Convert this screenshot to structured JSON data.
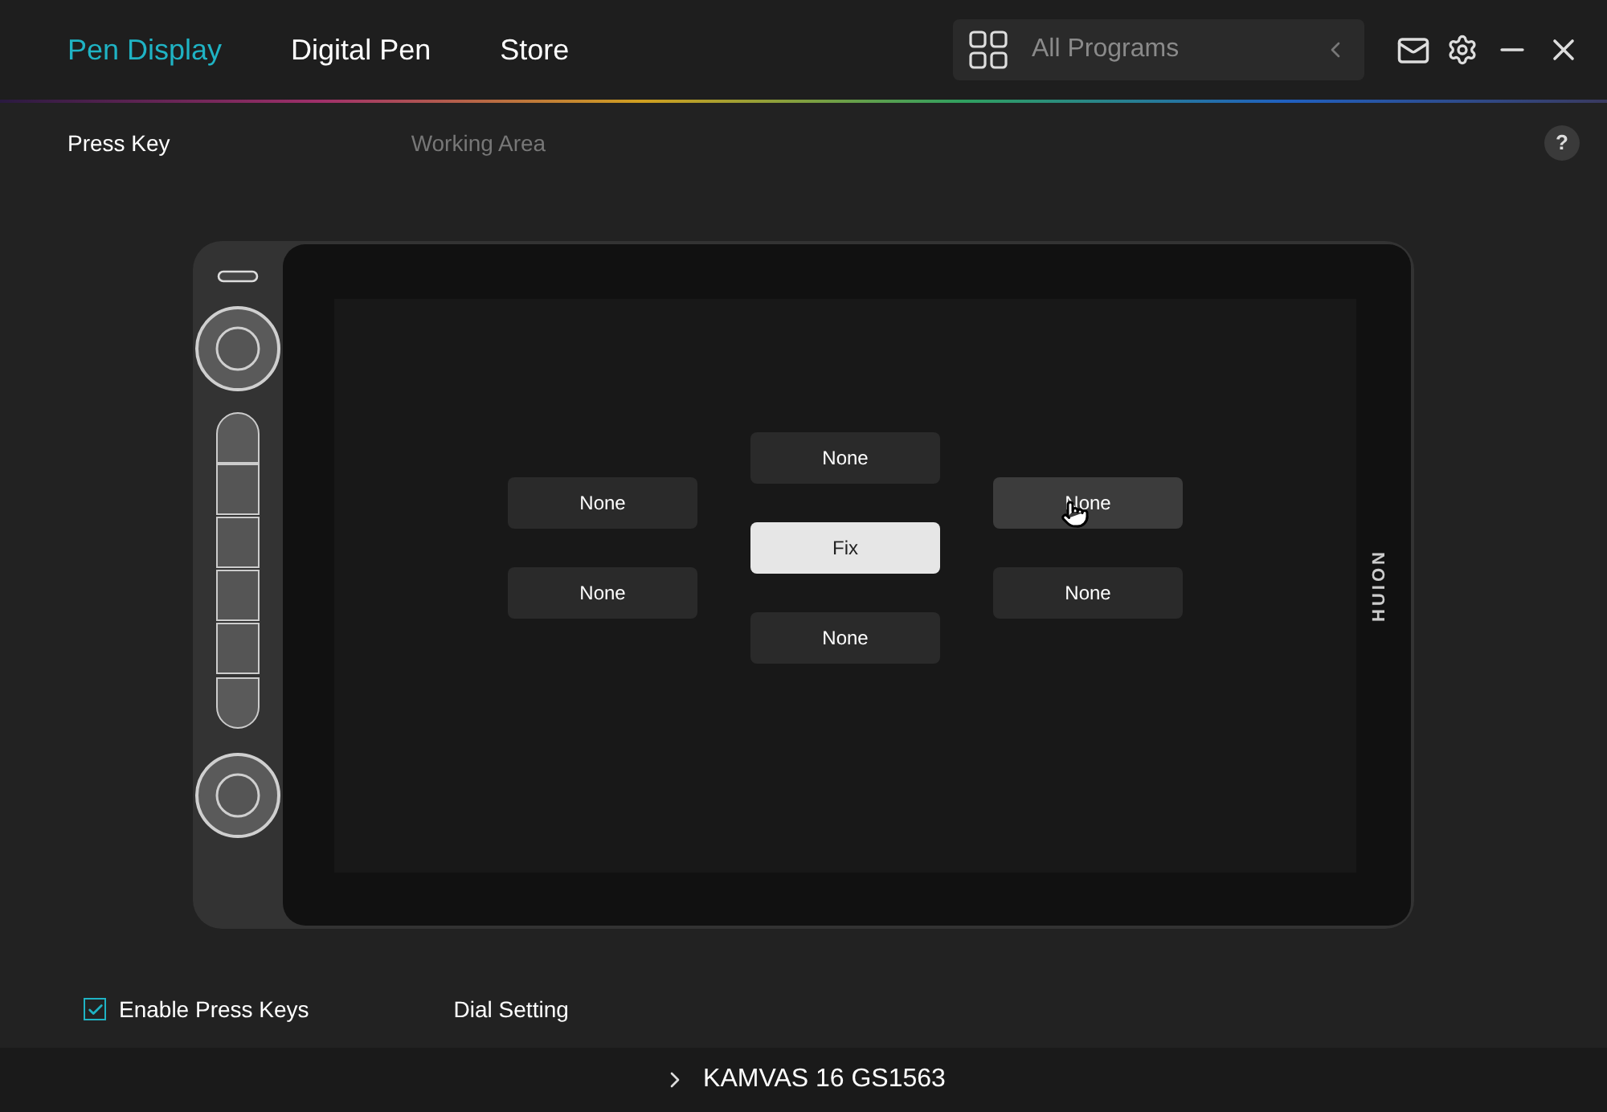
{
  "nav_tabs": [
    {
      "label": "Pen Display",
      "selected": true
    },
    {
      "label": "Digital Pen",
      "selected": false
    },
    {
      "label": "Store",
      "selected": false
    }
  ],
  "program_select": {
    "placeholder": "All Programs"
  },
  "sub_tabs": [
    {
      "label": "Press Key",
      "selected": true
    },
    {
      "label": "Working Area",
      "selected": false
    }
  ],
  "help": "?",
  "device_logo": "HUION",
  "key_columns": [
    [
      {
        "label": "None",
        "selected": false,
        "hovered": false
      },
      {
        "label": "None",
        "selected": false,
        "hovered": false
      }
    ],
    [
      {
        "label": "None",
        "selected": false,
        "hovered": false
      },
      {
        "label": "Fix",
        "selected": true,
        "hovered": false
      },
      {
        "label": "None",
        "selected": false,
        "hovered": false
      }
    ],
    [
      {
        "label": "None",
        "selected": false,
        "hovered": true
      },
      {
        "label": "None",
        "selected": false,
        "hovered": false
      }
    ]
  ],
  "enable_press_keys": {
    "label": "Enable Press Keys",
    "checked": true
  },
  "dial_setting": "Dial Setting",
  "device": "KAMVAS 16 GS1563"
}
